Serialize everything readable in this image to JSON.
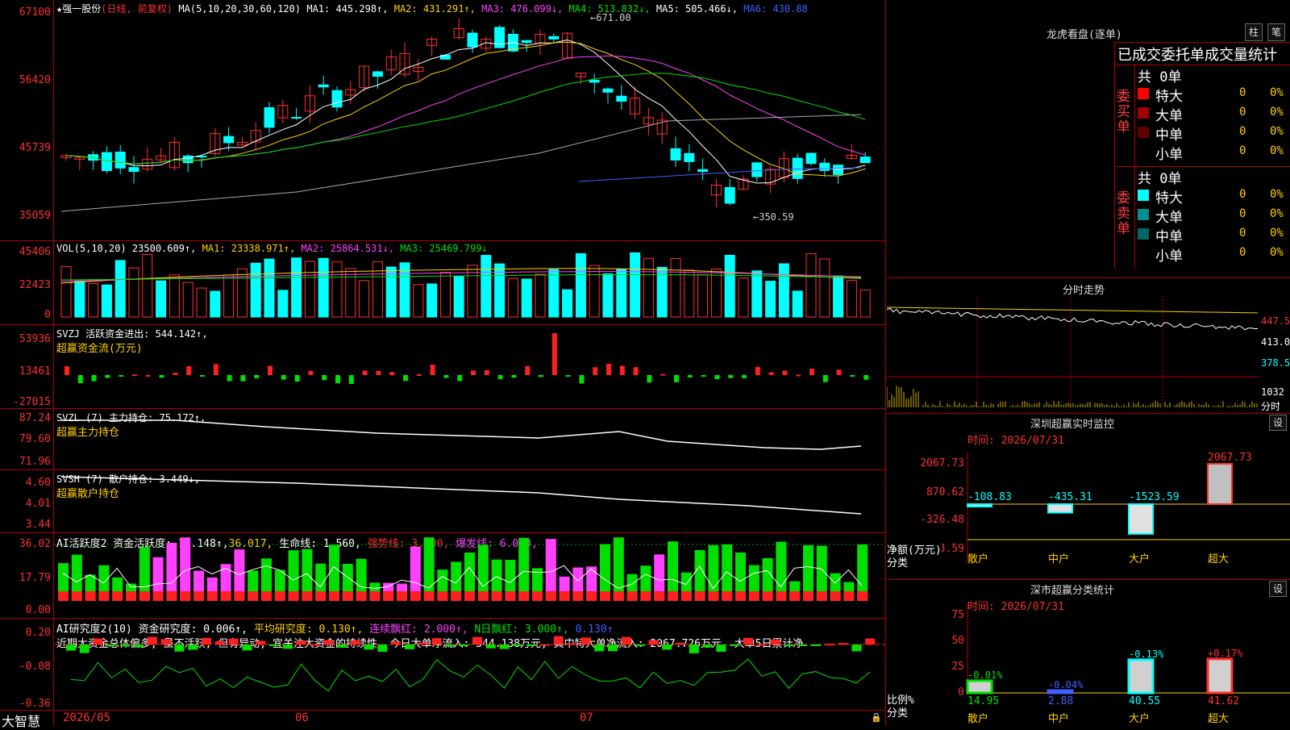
{
  "main_chart": {
    "header": {
      "star": "★",
      "stock_name": "强一股份",
      "period": "(日线, 前复权)",
      "ma_label": "MA(5,10,20,30,60,120)",
      "ma1": "MA1: 445.298↑,",
      "ma2": "MA2: 431.291↑,",
      "ma3": "MA3: 476.099↓,",
      "ma4": "MA4: 513.832↓,",
      "ma5": "MA5: 505.466↓,",
      "ma6": "MA6: 430.88"
    },
    "y_labels": [
      "67100",
      "56420",
      "45739",
      "35059"
    ],
    "high_label": "671.00",
    "low_label": "350.59",
    "colors": {
      "up": "#ff3030",
      "down": "#00ffff"
    }
  },
  "vol": {
    "header": "VOL(5,10,20)  23500.609↑,",
    "ma1": "MA1: 23338.971↑,",
    "ma2": "MA2: 25864.531↓,",
    "ma3": "MA3: 25469.799↓",
    "y_labels": [
      "45406",
      "22423",
      "0"
    ]
  },
  "svzj": {
    "header": "SVZJ  活跃资金进出: 544.142↑,",
    "sub": "超赢资金流(万元)",
    "y_labels": [
      "53936",
      "13461",
      "-27015"
    ]
  },
  "svzl": {
    "header": "SVZL (7) 主力持仓: 75.172↑,",
    "sub": "超赢主力持仓",
    "y_labels": [
      "87.24",
      "79.60",
      "71.96"
    ]
  },
  "svsh": {
    "header": "SVSH (7) 散户持仓: 3.449↓,",
    "sub": "超赢散户持仓",
    "y_labels": [
      "4.60",
      "4.01",
      "3.44"
    ]
  },
  "ai_active": {
    "header": "AI活跃度2 资金活跃度: 14.148↑,",
    "v2": "36.017,",
    "v3": "生命线: 1.560,",
    "v4": "强势线: 3.000,",
    "v5": "爆发线: 6.000,",
    "y_labels": [
      "36.02",
      "17.79",
      "0.00"
    ]
  },
  "ai_research": {
    "header": "AI研究度2(10) 资金研究度: 0.006↑,",
    "v2": "平均研究度: 0.130↑,",
    "v3": "连续飘红: 2.000↑,",
    "v4": "N日飘红: 3.000↑,",
    "v5": "0.130↑",
    "commentary": "近期大资金总体偏多, 虽不活跃, 但有异动, 宜关注大资金的持续性, 今日大单净流入: 544.138万元, 其中特大单净流入: 2067.726万元, 大单5日累计净",
    "y_labels": [
      "0.20",
      "-0.08",
      "-0.36"
    ]
  },
  "x_axis": {
    "brand": "大智慧",
    "labels": [
      "2026/05",
      "06",
      "07"
    ]
  },
  "dragon_tiger": {
    "title": "龙虎看盘(逐单)",
    "btn1": "柱",
    "btn2": "笔",
    "subtitle": "已成交委托单成交量统计",
    "buy_label": "委买单",
    "sell_label": "委卖单",
    "buy_total": "共 0单",
    "sell_total": "共 0单",
    "buy_rows": [
      {
        "name": "特大",
        "count": "0",
        "pct": "0%",
        "color": "#ff0000"
      },
      {
        "name": "大单",
        "count": "0",
        "pct": "0%",
        "color": "#a00000"
      },
      {
        "name": "中单",
        "count": "0",
        "pct": "0%",
        "color": "#600000"
      },
      {
        "name": "小单",
        "count": "0",
        "pct": "0%",
        "color": "#000000"
      }
    ],
    "sell_rows": [
      {
        "name": "特大",
        "count": "0",
        "pct": "0%",
        "color": "#00ffff"
      },
      {
        "name": "大单",
        "count": "0",
        "pct": "0%",
        "color": "#009090"
      },
      {
        "name": "中单",
        "count": "0",
        "pct": "0%",
        "color": "#006868"
      },
      {
        "name": "小单",
        "count": "0",
        "pct": "0%",
        "color": "#000000"
      }
    ]
  },
  "intraday": {
    "title": "分时走势",
    "y_labels": [
      "447.5",
      "413.0",
      "378.5"
    ],
    "vol_label": "1032",
    "vol_unit": "分时"
  },
  "realtime_monitor": {
    "title": "深圳超赢实时监控",
    "btn": "设",
    "time": "时间: 2026/07/31",
    "y_labels": [
      "2067.73",
      "870.62",
      "-326.48",
      "-1523.59"
    ],
    "unit_label": "净额(万元)",
    "cat_label": "分类",
    "categories": [
      "散户",
      "中户",
      "大户",
      "超大"
    ],
    "values": [
      "-108.83",
      "-435.31",
      "-1523.59",
      "2067.73"
    ]
  },
  "class_stats": {
    "title": "深市超赢分类统计",
    "btn": "设",
    "time": "时间: 2026/07/31",
    "y_labels": [
      "75",
      "50",
      "25",
      "0"
    ],
    "unit_label": "比例%",
    "cat_label": "分类",
    "categories": [
      "散户",
      "中户",
      "大户",
      "超大"
    ],
    "changes": [
      "-0.01%",
      "-0.04%",
      "-0.13%",
      "+0.17%"
    ],
    "values": [
      "14.95",
      "2.88",
      "40.55",
      "41.62"
    ]
  }
}
